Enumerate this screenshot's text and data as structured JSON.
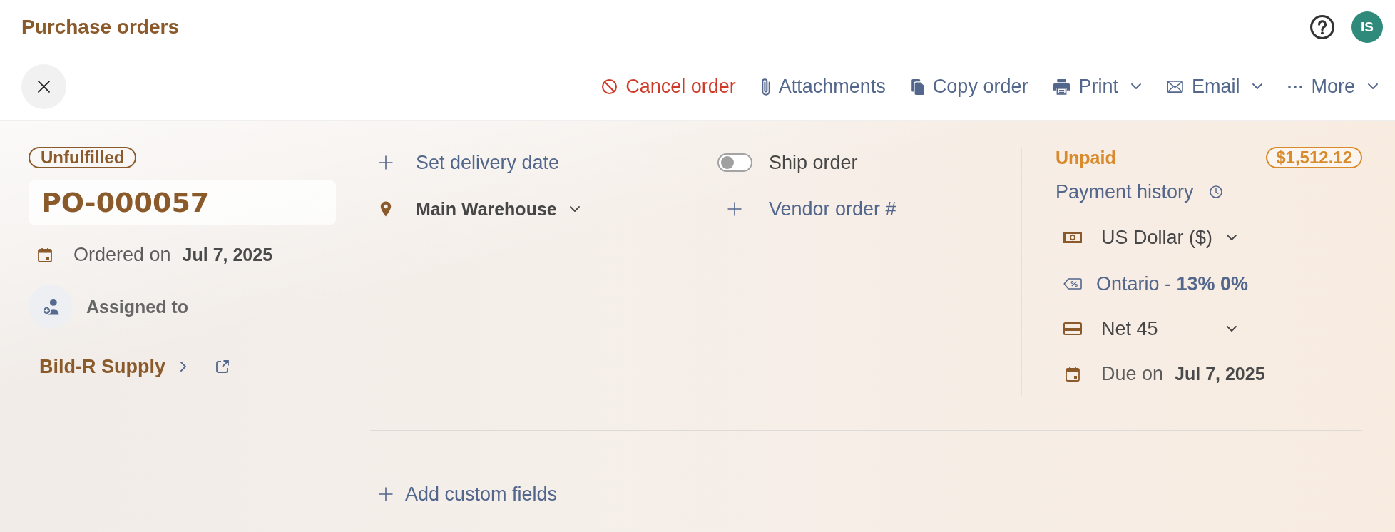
{
  "header": {
    "title": "Purchase orders",
    "avatar_initials": "IS"
  },
  "toolbar": {
    "actions": [
      {
        "kind": "cancel",
        "label": "Cancel order",
        "dropdown": false
      },
      {
        "kind": "attachments",
        "label": "Attachments",
        "dropdown": false
      },
      {
        "kind": "copy",
        "label": "Copy order",
        "dropdown": false
      },
      {
        "kind": "print",
        "label": "Print",
        "dropdown": true
      },
      {
        "kind": "email",
        "label": "Email",
        "dropdown": true
      },
      {
        "kind": "more",
        "label": "More",
        "dropdown": true
      }
    ]
  },
  "order": {
    "status": "Unfulfilled",
    "number": "PO-000057",
    "ordered_label": "Ordered on",
    "ordered_date": "Jul 7, 2025",
    "assigned_label": "Assigned to",
    "vendor": "Bild-R Supply"
  },
  "delivery": {
    "set_date": "Set delivery date",
    "warehouse": "Main Warehouse",
    "ship_order": {
      "label": "Ship order",
      "on": false
    },
    "vendor_order": "Vendor order #"
  },
  "payment": {
    "status": "Unpaid",
    "amount": "$1,512.12",
    "history": "Payment history",
    "currency": "US Dollar ($)",
    "tax": "Ontario - **13% 0%**",
    "terms": "Net 45",
    "due_label": "Due on",
    "due_date": "Jul 7, 2025"
  },
  "custom_fields": {
    "add_label": "Add custom fields"
  }
}
